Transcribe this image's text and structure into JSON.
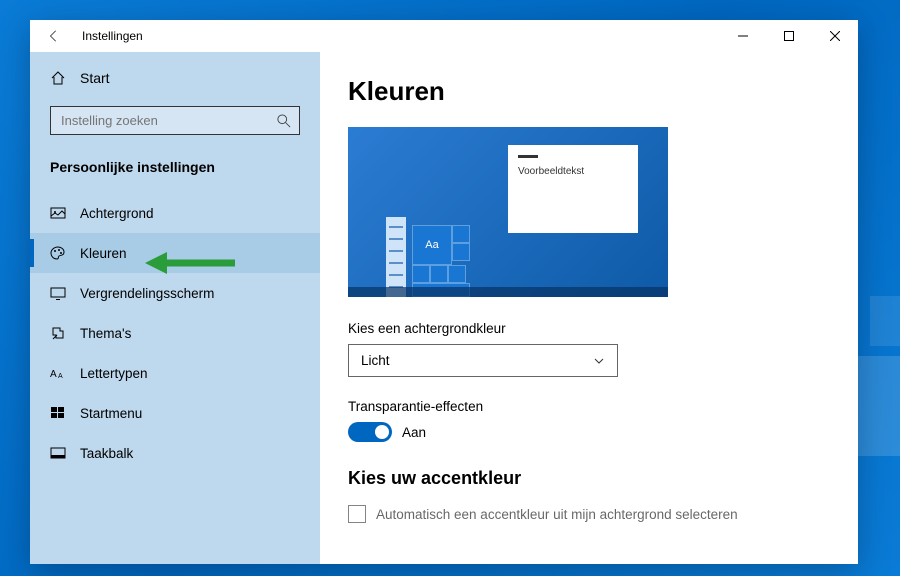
{
  "window": {
    "title": "Instellingen"
  },
  "sidebar": {
    "home": "Start",
    "search_placeholder": "Instelling zoeken",
    "section_title": "Persoonlijke instellingen",
    "items": [
      {
        "label": "Achtergrond"
      },
      {
        "label": "Kleuren"
      },
      {
        "label": "Vergrendelingsscherm"
      },
      {
        "label": "Thema's"
      },
      {
        "label": "Lettertypen"
      },
      {
        "label": "Startmenu"
      },
      {
        "label": "Taakbalk"
      }
    ]
  },
  "main": {
    "title": "Kleuren",
    "preview_sample": "Voorbeeldtekst",
    "preview_aa": "Aa",
    "color_mode_label": "Kies een achtergrondkleur",
    "color_mode_value": "Licht",
    "transparency_label": "Transparantie-effecten",
    "transparency_value": "Aan",
    "accent_heading": "Kies uw accentkleur",
    "auto_accent_label": "Automatisch een accentkleur uit mijn achtergrond selecteren"
  }
}
